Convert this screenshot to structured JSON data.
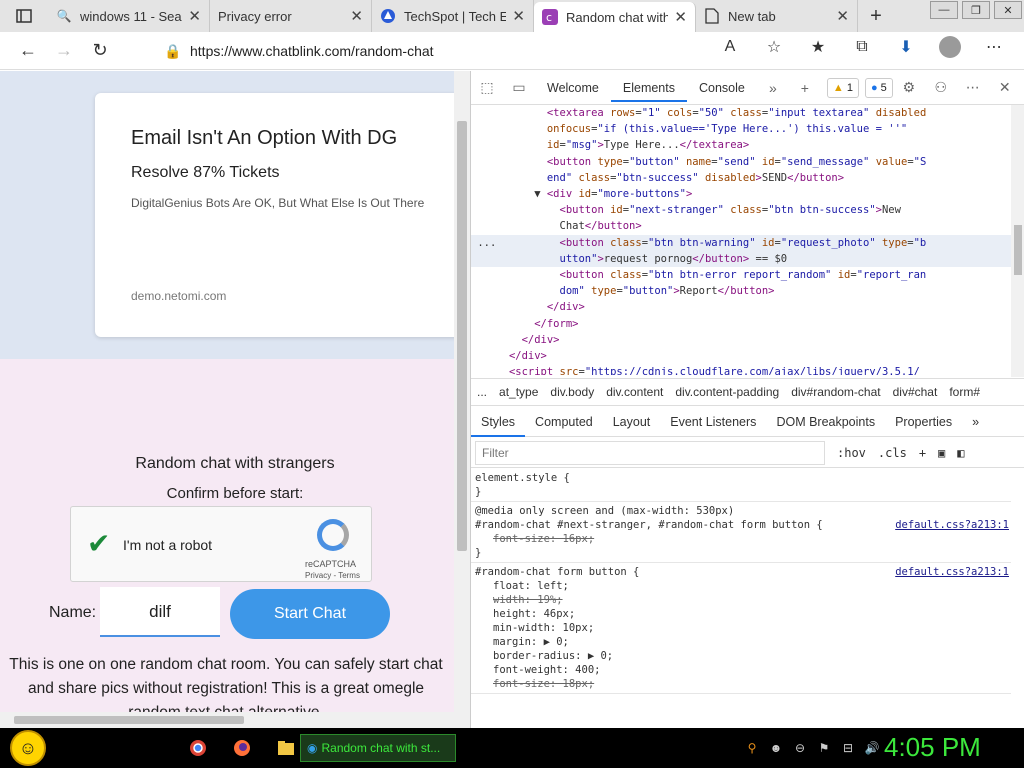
{
  "browser": {
    "tabs": [
      {
        "label": "windows 11 - Sea",
        "icon": "search-icon",
        "active": false
      },
      {
        "label": "Privacy error",
        "icon": "",
        "active": false
      },
      {
        "label": "TechSpot | Tech E",
        "icon": "techspot-icon",
        "active": false
      },
      {
        "label": "Random chat with",
        "icon": "chatblink-icon",
        "active": true
      },
      {
        "label": "New tab",
        "icon": "page-icon",
        "active": false
      }
    ],
    "url": "https://www.chatblink.com/random-chat"
  },
  "ad": {
    "title": "Email Isn't An Option With DG",
    "subtitle": "Resolve 87% Tickets",
    "text": "DigitalGenius Bots Are OK, But What Else Is Out There",
    "domain": "demo.netomi.com"
  },
  "chat": {
    "heading": "Random chat with strangers",
    "confirm": "Confirm before start:",
    "captcha_label": "I'm not a robot",
    "captcha_brand": "reCAPTCHA",
    "captcha_links": "Privacy - Terms",
    "name_label": "Name:",
    "name_value": "dilf",
    "start_label": "Start Chat",
    "description": "This is one on one random chat room. You can safely start chat and share pics without registration! This is a great omegle random text chat alternative."
  },
  "devtools": {
    "tabs": [
      "Welcome",
      "Elements",
      "Console"
    ],
    "warnings": "1",
    "messages": "5",
    "breadcrumb": [
      "...",
      "at_type",
      "div.body",
      "div.content",
      "div.content-padding",
      "div#random-chat",
      "div#chat",
      "form#"
    ],
    "style_tabs": [
      "Styles",
      "Computed",
      "Layout",
      "Event Listeners",
      "DOM Breakpoints",
      "Properties"
    ],
    "filter_placeholder": "Filter",
    "hov": ":hov",
    "cls": ".cls"
  },
  "taskbar": {
    "task_label": "Random chat with st...",
    "clock": "4:05 PM"
  }
}
